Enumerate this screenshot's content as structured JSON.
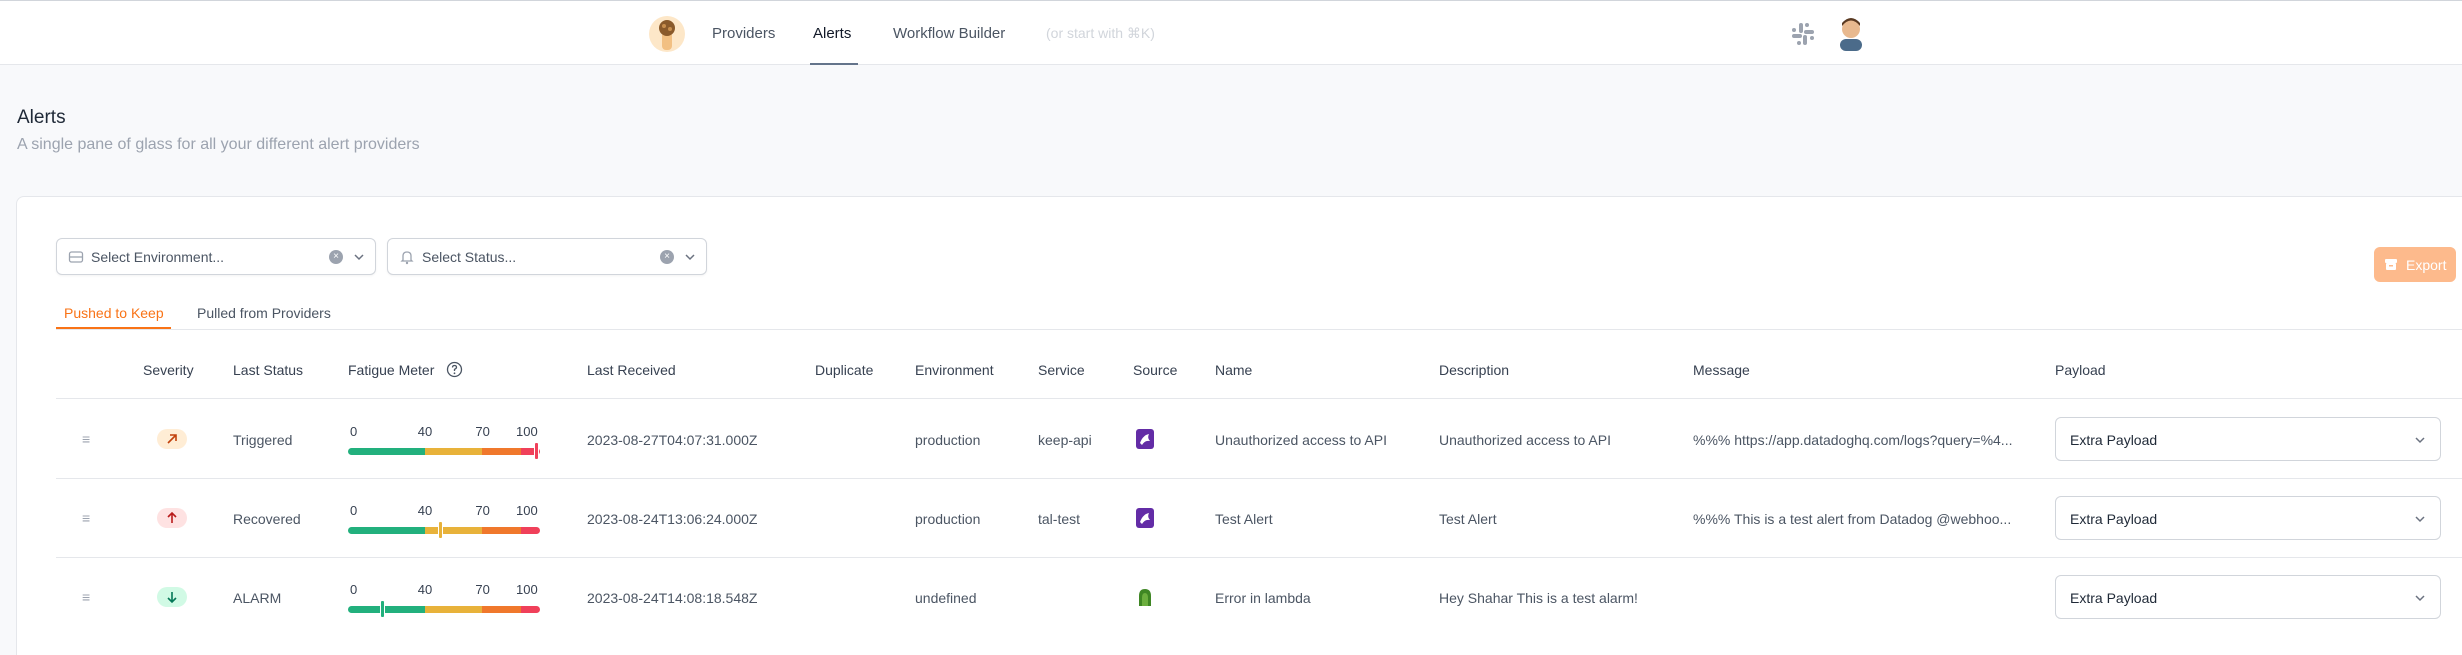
{
  "nav": {
    "links": [
      "Providers",
      "Alerts",
      "Workflow Builder"
    ],
    "active": "Alerts",
    "search_hint": "(or start with ⌘K)"
  },
  "header": {
    "title": "Alerts",
    "subtitle": "A single pane of glass for all your different alert providers"
  },
  "filters": {
    "environment_placeholder": "Select Environment...",
    "status_placeholder": "Select Status..."
  },
  "export_label": "Export",
  "tabs": [
    "Pushed to Keep",
    "Pulled from Providers"
  ],
  "active_tab": "Pushed to Keep",
  "columns": [
    "Severity",
    "Last Status",
    "Fatigue Meter",
    "Last Received",
    "Duplicate",
    "Environment",
    "Service",
    "Source",
    "Name",
    "Description",
    "Message",
    "Payload"
  ],
  "fatigue_ticks": [
    "0",
    "40",
    "70",
    "100"
  ],
  "rows": [
    {
      "severity": "high",
      "severity_icon": "arrow-up-right-icon",
      "last_status": "Triggered",
      "fatigue_level": 98,
      "last_received": "2023-08-27T04:07:31.000Z",
      "duplicate": "",
      "environment": "production",
      "service": "keep-api",
      "source": "datadog",
      "name": "Unauthorized access to API",
      "description": "Unauthorized access to API",
      "message": "%%% https://app.datadoghq.com/logs?query=%4...",
      "payload": "Extra Payload"
    },
    {
      "severity": "critical",
      "severity_icon": "arrow-up-icon",
      "last_status": "Recovered",
      "fatigue_level": 48,
      "last_received": "2023-08-24T13:06:24.000Z",
      "duplicate": "",
      "environment": "production",
      "service": "tal-test",
      "source": "datadog",
      "name": "Test Alert",
      "description": "Test Alert",
      "message": "%%% This is a test alert from Datadog @webhoo...",
      "payload": "Extra Payload"
    },
    {
      "severity": "low",
      "severity_icon": "arrow-down-icon",
      "last_status": "ALARM",
      "fatigue_level": 18,
      "last_received": "2023-08-24T14:08:18.548Z",
      "duplicate": "",
      "environment": "undefined",
      "service": "",
      "source": "cloudwatch",
      "name": "Error in lambda",
      "description": "Hey Shahar This is a test alarm!",
      "message": "",
      "payload": "Extra Payload"
    }
  ],
  "colors": {
    "accent": "#f97316",
    "meter_green": "#22b07d",
    "meter_yellow": "#e8b23a",
    "meter_orange": "#f0782c",
    "meter_red": "#f0405a"
  }
}
